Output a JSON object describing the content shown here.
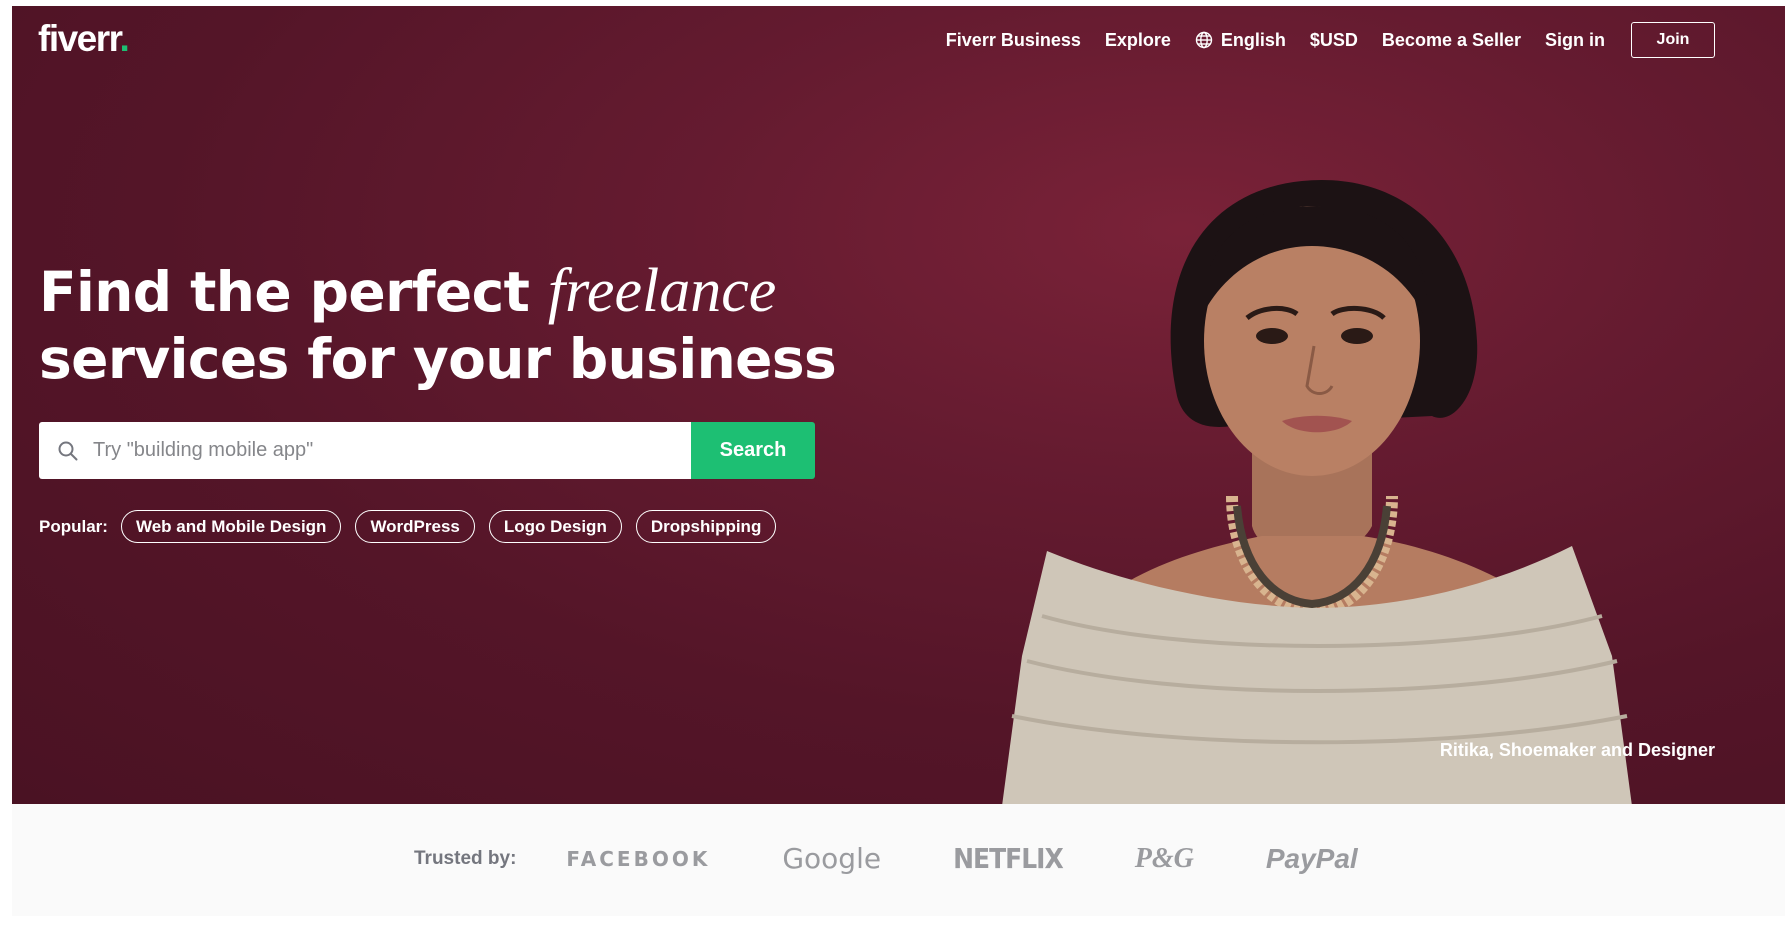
{
  "header": {
    "logo_text": "fiverr",
    "logo_dot": ".",
    "nav": {
      "fiverr_business": "Fiverr Business",
      "explore": "Explore",
      "language": "English",
      "currency": "$USD",
      "become_seller": "Become a Seller",
      "sign_in": "Sign in",
      "join": "Join"
    }
  },
  "hero": {
    "headline_part1": "Find the perfect ",
    "headline_accent": "freelance",
    "headline_line2": "services for your business",
    "search": {
      "placeholder": "Try \"building mobile app\"",
      "button_label": "Search"
    },
    "popular": {
      "label": "Popular:",
      "tags": [
        "Web and Mobile Design",
        "WordPress",
        "Logo Design",
        "Dropshipping"
      ]
    },
    "caption": "Ritika, Shoemaker and Designer"
  },
  "trusted": {
    "label": "Trusted by:",
    "brands": [
      "FACEBOOK",
      "Google",
      "NETFLIX",
      "P&G",
      "PayPal"
    ]
  },
  "colors": {
    "hero_bg": "#5c1a2e",
    "accent_green": "#1dbf73",
    "trusted_bg": "#fafafa"
  },
  "icons": {
    "language": "globe-icon",
    "search": "search-icon"
  }
}
